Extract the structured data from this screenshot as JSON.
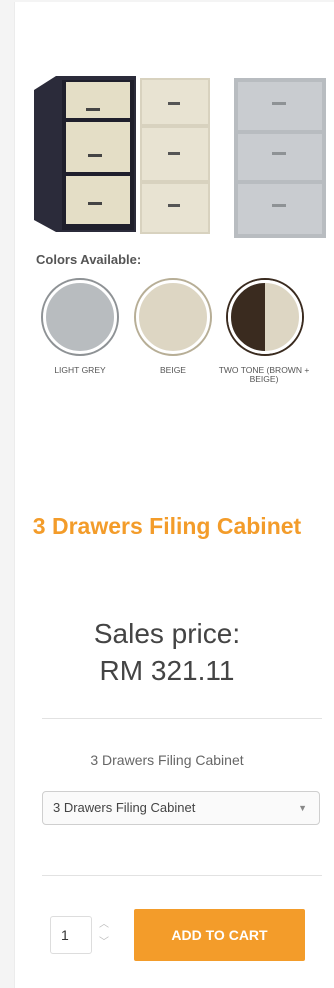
{
  "product": {
    "title": "3 Drawers Filing Cabinet",
    "price_label": "Sales price:",
    "price_value": "RM 321.11"
  },
  "colors": {
    "title": "Colors Available:",
    "options": [
      {
        "label": "LIGHT GREY",
        "color": "#b8bcbf"
      },
      {
        "label": "BEIGE",
        "color": "#ddd6c3"
      },
      {
        "label": "TWO TONE (BROWN + BEIGE)",
        "color_left": "#3a2b1f",
        "color_right": "#ddd6c3"
      }
    ]
  },
  "variant": {
    "label": "3 Drawers Filing Cabinet",
    "selected": "3 Drawers Filing Cabinet"
  },
  "cart": {
    "quantity": "1",
    "add_label": "ADD TO CART"
  },
  "theme": {
    "accent": "#f39c2a"
  }
}
